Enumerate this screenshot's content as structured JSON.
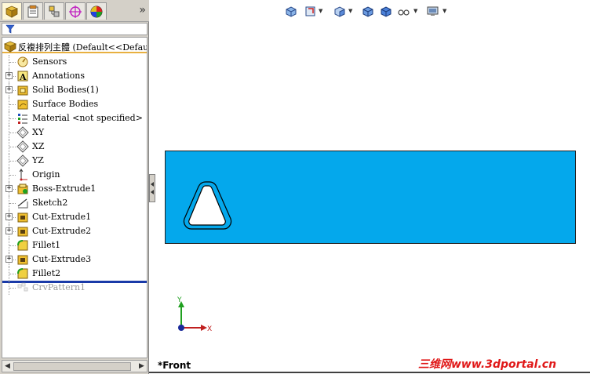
{
  "feature_tree": {
    "root_label": "反複排列主體  (Default<<Default>",
    "items": [
      {
        "label": "Sensors",
        "icon": "sensor-icon",
        "expandable": false
      },
      {
        "label": "Annotations",
        "icon": "annotations-icon",
        "expandable": true
      },
      {
        "label": "Solid Bodies(1)",
        "icon": "solid-bodies-icon",
        "expandable": true
      },
      {
        "label": "Surface Bodies",
        "icon": "surface-bodies-icon",
        "expandable": false
      },
      {
        "label": "Material <not specified>",
        "icon": "material-icon",
        "expandable": false
      },
      {
        "label": "XY",
        "icon": "plane-icon",
        "expandable": false
      },
      {
        "label": "XZ",
        "icon": "plane-icon",
        "expandable": false
      },
      {
        "label": "YZ",
        "icon": "plane-icon",
        "expandable": false
      },
      {
        "label": "Origin",
        "icon": "origin-icon",
        "expandable": false
      },
      {
        "label": "Boss-Extrude1",
        "icon": "boss-extrude-icon",
        "expandable": true
      },
      {
        "label": "Sketch2",
        "icon": "sketch-icon",
        "expandable": false
      },
      {
        "label": "Cut-Extrude1",
        "icon": "cut-extrude-icon",
        "expandable": true
      },
      {
        "label": "Cut-Extrude2",
        "icon": "cut-extrude-icon",
        "expandable": true
      },
      {
        "label": "Fillet1",
        "icon": "fillet-icon",
        "expandable": false
      },
      {
        "label": "Cut-Extrude3",
        "icon": "cut-extrude-icon",
        "expandable": true
      },
      {
        "label": "Fillet2",
        "icon": "fillet-icon",
        "expandable": false
      },
      {
        "label": "CrvPattern1",
        "icon": "curve-pattern-icon",
        "expandable": false,
        "suppressed": true
      }
    ]
  },
  "viewport": {
    "view_name": "*Front",
    "triad": {
      "x_label": "X",
      "y_label": "Y"
    },
    "part_color": "#04a8ec"
  },
  "watermark": "三维网www.3dportal.cn",
  "tabs_more": "»"
}
